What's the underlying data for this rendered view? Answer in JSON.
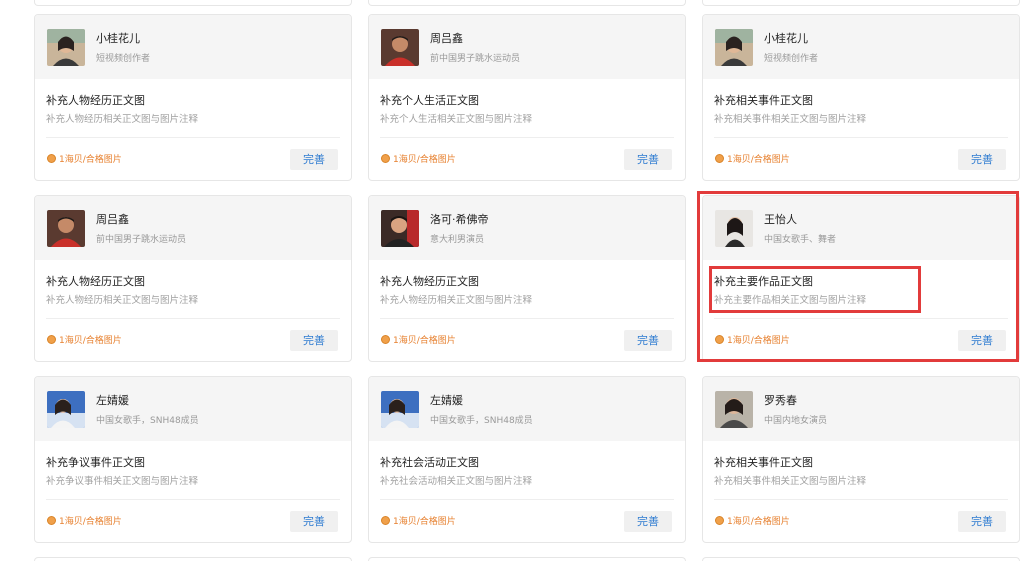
{
  "cards": [
    {
      "name": "小桂花儿",
      "desc": "短视频创作者",
      "task_title": "补充人物经历正文图",
      "task_desc": "补充人物经历相关正文图与图片注释",
      "reward": "1海贝/合格图片",
      "button": "完善"
    },
    {
      "name": "周吕鑫",
      "desc": "前中国男子跳水运动员",
      "task_title": "补充个人生活正文图",
      "task_desc": "补充个人生活相关正文图与图片注释",
      "reward": "1海贝/合格图片",
      "button": "完善"
    },
    {
      "name": "小桂花儿",
      "desc": "短视频创作者",
      "task_title": "补充相关事件正文图",
      "task_desc": "补充相关事件相关正文图与图片注释",
      "reward": "1海贝/合格图片",
      "button": "完善"
    },
    {
      "name": "周吕鑫",
      "desc": "前中国男子跳水运动员",
      "task_title": "补充人物经历正文图",
      "task_desc": "补充人物经历相关正文图与图片注释",
      "reward": "1海贝/合格图片",
      "button": "完善"
    },
    {
      "name": "洛可·希佛帝",
      "desc": "意大利男演员",
      "task_title": "补充人物经历正文图",
      "task_desc": "补充人物经历相关正文图与图片注释",
      "reward": "1海贝/合格图片",
      "button": "完善"
    },
    {
      "name": "王怡人",
      "desc": "中国女歌手、舞者",
      "task_title": "补充主要作品正文图",
      "task_desc": "补充主要作品相关正文图与图片注释",
      "reward": "1海贝/合格图片",
      "button": "完善"
    },
    {
      "name": "左婧媛",
      "desc": "中国女歌手，SNH48成员",
      "task_title": "补充争议事件正文图",
      "task_desc": "补充争议事件相关正文图与图片注释",
      "reward": "1海贝/合格图片",
      "button": "完善"
    },
    {
      "name": "左婧媛",
      "desc": "中国女歌手，SNH48成员",
      "task_title": "补充社会活动正文图",
      "task_desc": "补充社会活动相关正文图与图片注释",
      "reward": "1海贝/合格图片",
      "button": "完善"
    },
    {
      "name": "罗秀春",
      "desc": "中国内地女演员",
      "task_title": "补充相关事件正文图",
      "task_desc": "补充相关事件相关正文图与图片注释",
      "reward": "1海贝/合格图片",
      "button": "完善"
    }
  ],
  "colors": {
    "accent_button_text": "#2e7bd1",
    "reward_text": "#e7802f",
    "highlight": "#e23b3b"
  }
}
